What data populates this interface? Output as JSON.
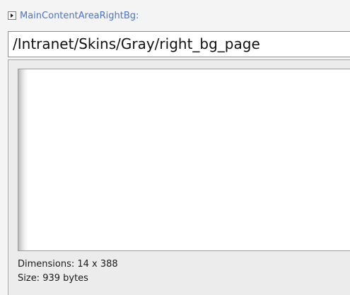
{
  "property": {
    "name": "MainContentAreaRightBg:",
    "value": "/Intranet/Skins/Gray/right_bg_page",
    "toggle_icon": "expand-arrow-icon"
  },
  "preview": {
    "dimensions_text": "Dimensions: 14 x 388",
    "size_text": "Size: 939 bytes"
  },
  "colors": {
    "label": "#4a74c9",
    "panel_bg": "#ececec",
    "page_bg": "#f4f4f4"
  }
}
